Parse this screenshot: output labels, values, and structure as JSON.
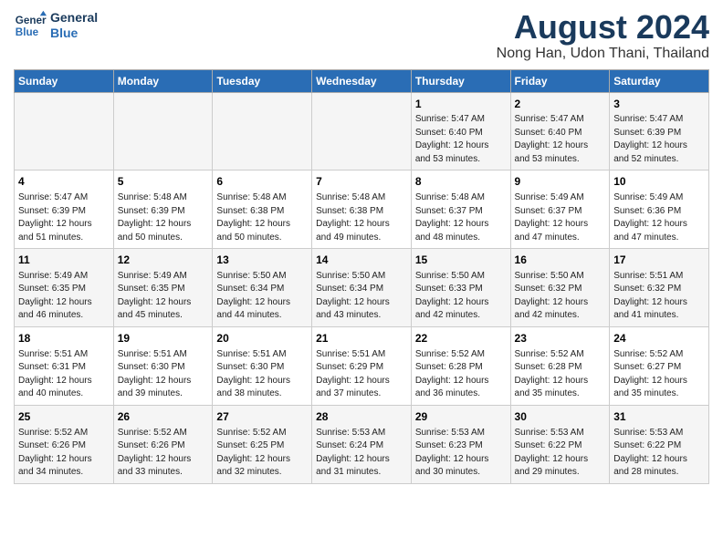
{
  "header": {
    "logo_line1": "General",
    "logo_line2": "Blue",
    "title": "August 2024",
    "subtitle": "Nong Han, Udon Thani, Thailand"
  },
  "days_of_week": [
    "Sunday",
    "Monday",
    "Tuesday",
    "Wednesday",
    "Thursday",
    "Friday",
    "Saturday"
  ],
  "weeks": [
    [
      {
        "day": "",
        "info": ""
      },
      {
        "day": "",
        "info": ""
      },
      {
        "day": "",
        "info": ""
      },
      {
        "day": "",
        "info": ""
      },
      {
        "day": "1",
        "info": "Sunrise: 5:47 AM\nSunset: 6:40 PM\nDaylight: 12 hours\nand 53 minutes."
      },
      {
        "day": "2",
        "info": "Sunrise: 5:47 AM\nSunset: 6:40 PM\nDaylight: 12 hours\nand 53 minutes."
      },
      {
        "day": "3",
        "info": "Sunrise: 5:47 AM\nSunset: 6:39 PM\nDaylight: 12 hours\nand 52 minutes."
      }
    ],
    [
      {
        "day": "4",
        "info": "Sunrise: 5:47 AM\nSunset: 6:39 PM\nDaylight: 12 hours\nand 51 minutes."
      },
      {
        "day": "5",
        "info": "Sunrise: 5:48 AM\nSunset: 6:39 PM\nDaylight: 12 hours\nand 50 minutes."
      },
      {
        "day": "6",
        "info": "Sunrise: 5:48 AM\nSunset: 6:38 PM\nDaylight: 12 hours\nand 50 minutes."
      },
      {
        "day": "7",
        "info": "Sunrise: 5:48 AM\nSunset: 6:38 PM\nDaylight: 12 hours\nand 49 minutes."
      },
      {
        "day": "8",
        "info": "Sunrise: 5:48 AM\nSunset: 6:37 PM\nDaylight: 12 hours\nand 48 minutes."
      },
      {
        "day": "9",
        "info": "Sunrise: 5:49 AM\nSunset: 6:37 PM\nDaylight: 12 hours\nand 47 minutes."
      },
      {
        "day": "10",
        "info": "Sunrise: 5:49 AM\nSunset: 6:36 PM\nDaylight: 12 hours\nand 47 minutes."
      }
    ],
    [
      {
        "day": "11",
        "info": "Sunrise: 5:49 AM\nSunset: 6:35 PM\nDaylight: 12 hours\nand 46 minutes."
      },
      {
        "day": "12",
        "info": "Sunrise: 5:49 AM\nSunset: 6:35 PM\nDaylight: 12 hours\nand 45 minutes."
      },
      {
        "day": "13",
        "info": "Sunrise: 5:50 AM\nSunset: 6:34 PM\nDaylight: 12 hours\nand 44 minutes."
      },
      {
        "day": "14",
        "info": "Sunrise: 5:50 AM\nSunset: 6:34 PM\nDaylight: 12 hours\nand 43 minutes."
      },
      {
        "day": "15",
        "info": "Sunrise: 5:50 AM\nSunset: 6:33 PM\nDaylight: 12 hours\nand 42 minutes."
      },
      {
        "day": "16",
        "info": "Sunrise: 5:50 AM\nSunset: 6:32 PM\nDaylight: 12 hours\nand 42 minutes."
      },
      {
        "day": "17",
        "info": "Sunrise: 5:51 AM\nSunset: 6:32 PM\nDaylight: 12 hours\nand 41 minutes."
      }
    ],
    [
      {
        "day": "18",
        "info": "Sunrise: 5:51 AM\nSunset: 6:31 PM\nDaylight: 12 hours\nand 40 minutes."
      },
      {
        "day": "19",
        "info": "Sunrise: 5:51 AM\nSunset: 6:30 PM\nDaylight: 12 hours\nand 39 minutes."
      },
      {
        "day": "20",
        "info": "Sunrise: 5:51 AM\nSunset: 6:30 PM\nDaylight: 12 hours\nand 38 minutes."
      },
      {
        "day": "21",
        "info": "Sunrise: 5:51 AM\nSunset: 6:29 PM\nDaylight: 12 hours\nand 37 minutes."
      },
      {
        "day": "22",
        "info": "Sunrise: 5:52 AM\nSunset: 6:28 PM\nDaylight: 12 hours\nand 36 minutes."
      },
      {
        "day": "23",
        "info": "Sunrise: 5:52 AM\nSunset: 6:28 PM\nDaylight: 12 hours\nand 35 minutes."
      },
      {
        "day": "24",
        "info": "Sunrise: 5:52 AM\nSunset: 6:27 PM\nDaylight: 12 hours\nand 35 minutes."
      }
    ],
    [
      {
        "day": "25",
        "info": "Sunrise: 5:52 AM\nSunset: 6:26 PM\nDaylight: 12 hours\nand 34 minutes."
      },
      {
        "day": "26",
        "info": "Sunrise: 5:52 AM\nSunset: 6:26 PM\nDaylight: 12 hours\nand 33 minutes."
      },
      {
        "day": "27",
        "info": "Sunrise: 5:52 AM\nSunset: 6:25 PM\nDaylight: 12 hours\nand 32 minutes."
      },
      {
        "day": "28",
        "info": "Sunrise: 5:53 AM\nSunset: 6:24 PM\nDaylight: 12 hours\nand 31 minutes."
      },
      {
        "day": "29",
        "info": "Sunrise: 5:53 AM\nSunset: 6:23 PM\nDaylight: 12 hours\nand 30 minutes."
      },
      {
        "day": "30",
        "info": "Sunrise: 5:53 AM\nSunset: 6:22 PM\nDaylight: 12 hours\nand 29 minutes."
      },
      {
        "day": "31",
        "info": "Sunrise: 5:53 AM\nSunset: 6:22 PM\nDaylight: 12 hours\nand 28 minutes."
      }
    ]
  ]
}
